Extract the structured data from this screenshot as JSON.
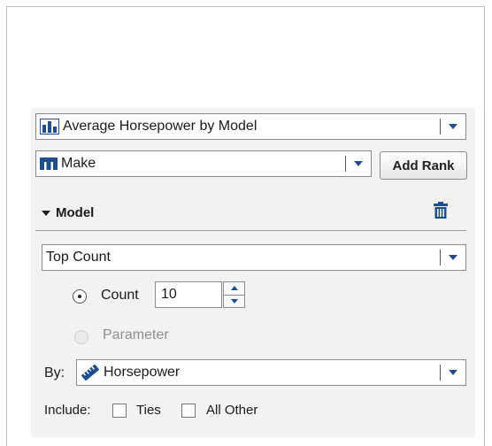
{
  "chart_selector": {
    "value": "Average Horsepower by Model",
    "icon": "bar-chart-icon"
  },
  "category_selector": {
    "value": "Make",
    "icon": "category-icon"
  },
  "add_rank_button": "Add Rank",
  "rank_section": {
    "title": "Model",
    "rank_type": "Top Count",
    "count_label": "Count",
    "count_value": "10",
    "parameter_label": "Parameter",
    "by_label": "By:",
    "by_value": "Horsepower",
    "by_icon": "measure-icon",
    "include_label": "Include:",
    "ties_label": "Ties",
    "all_other_label": "All Other"
  },
  "colors": {
    "accent": "#1e4f8c",
    "panel_bg": "#f2f2f2"
  }
}
